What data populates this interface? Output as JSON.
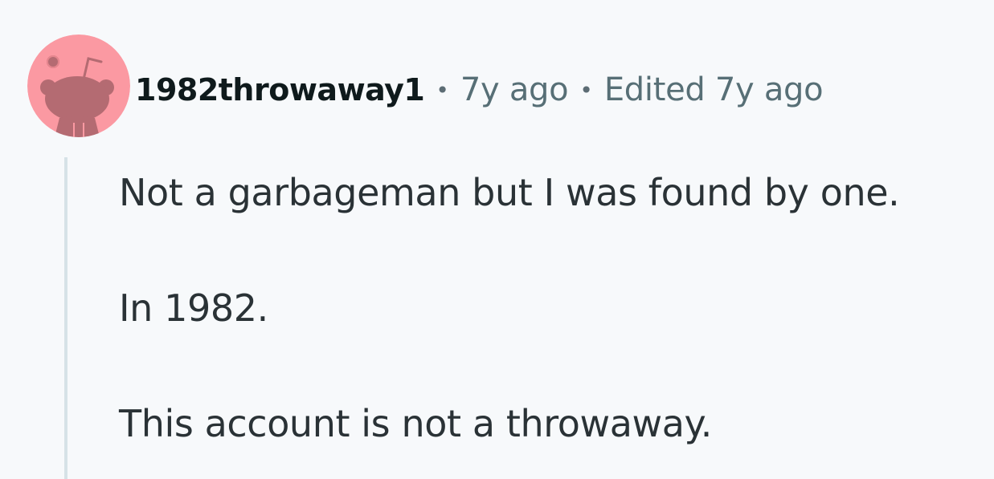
{
  "comment": {
    "author": "1982throwaway1",
    "separator": "•",
    "posted": "7y ago",
    "edited": "Edited 7y ago",
    "paragraphs": [
      "Not a garbageman but I was found by one.",
      "In 1982.",
      "This account is not a throwaway."
    ]
  },
  "avatar": {
    "icon": "snoo-avatar-icon",
    "background_color": "#fb99a2",
    "figure_color": "#b46b72"
  },
  "colors": {
    "page_background": "#f7f9fb",
    "thread_line": "#d6e2e7",
    "meta_text": "#576f76",
    "body_text": "#2a3236"
  }
}
